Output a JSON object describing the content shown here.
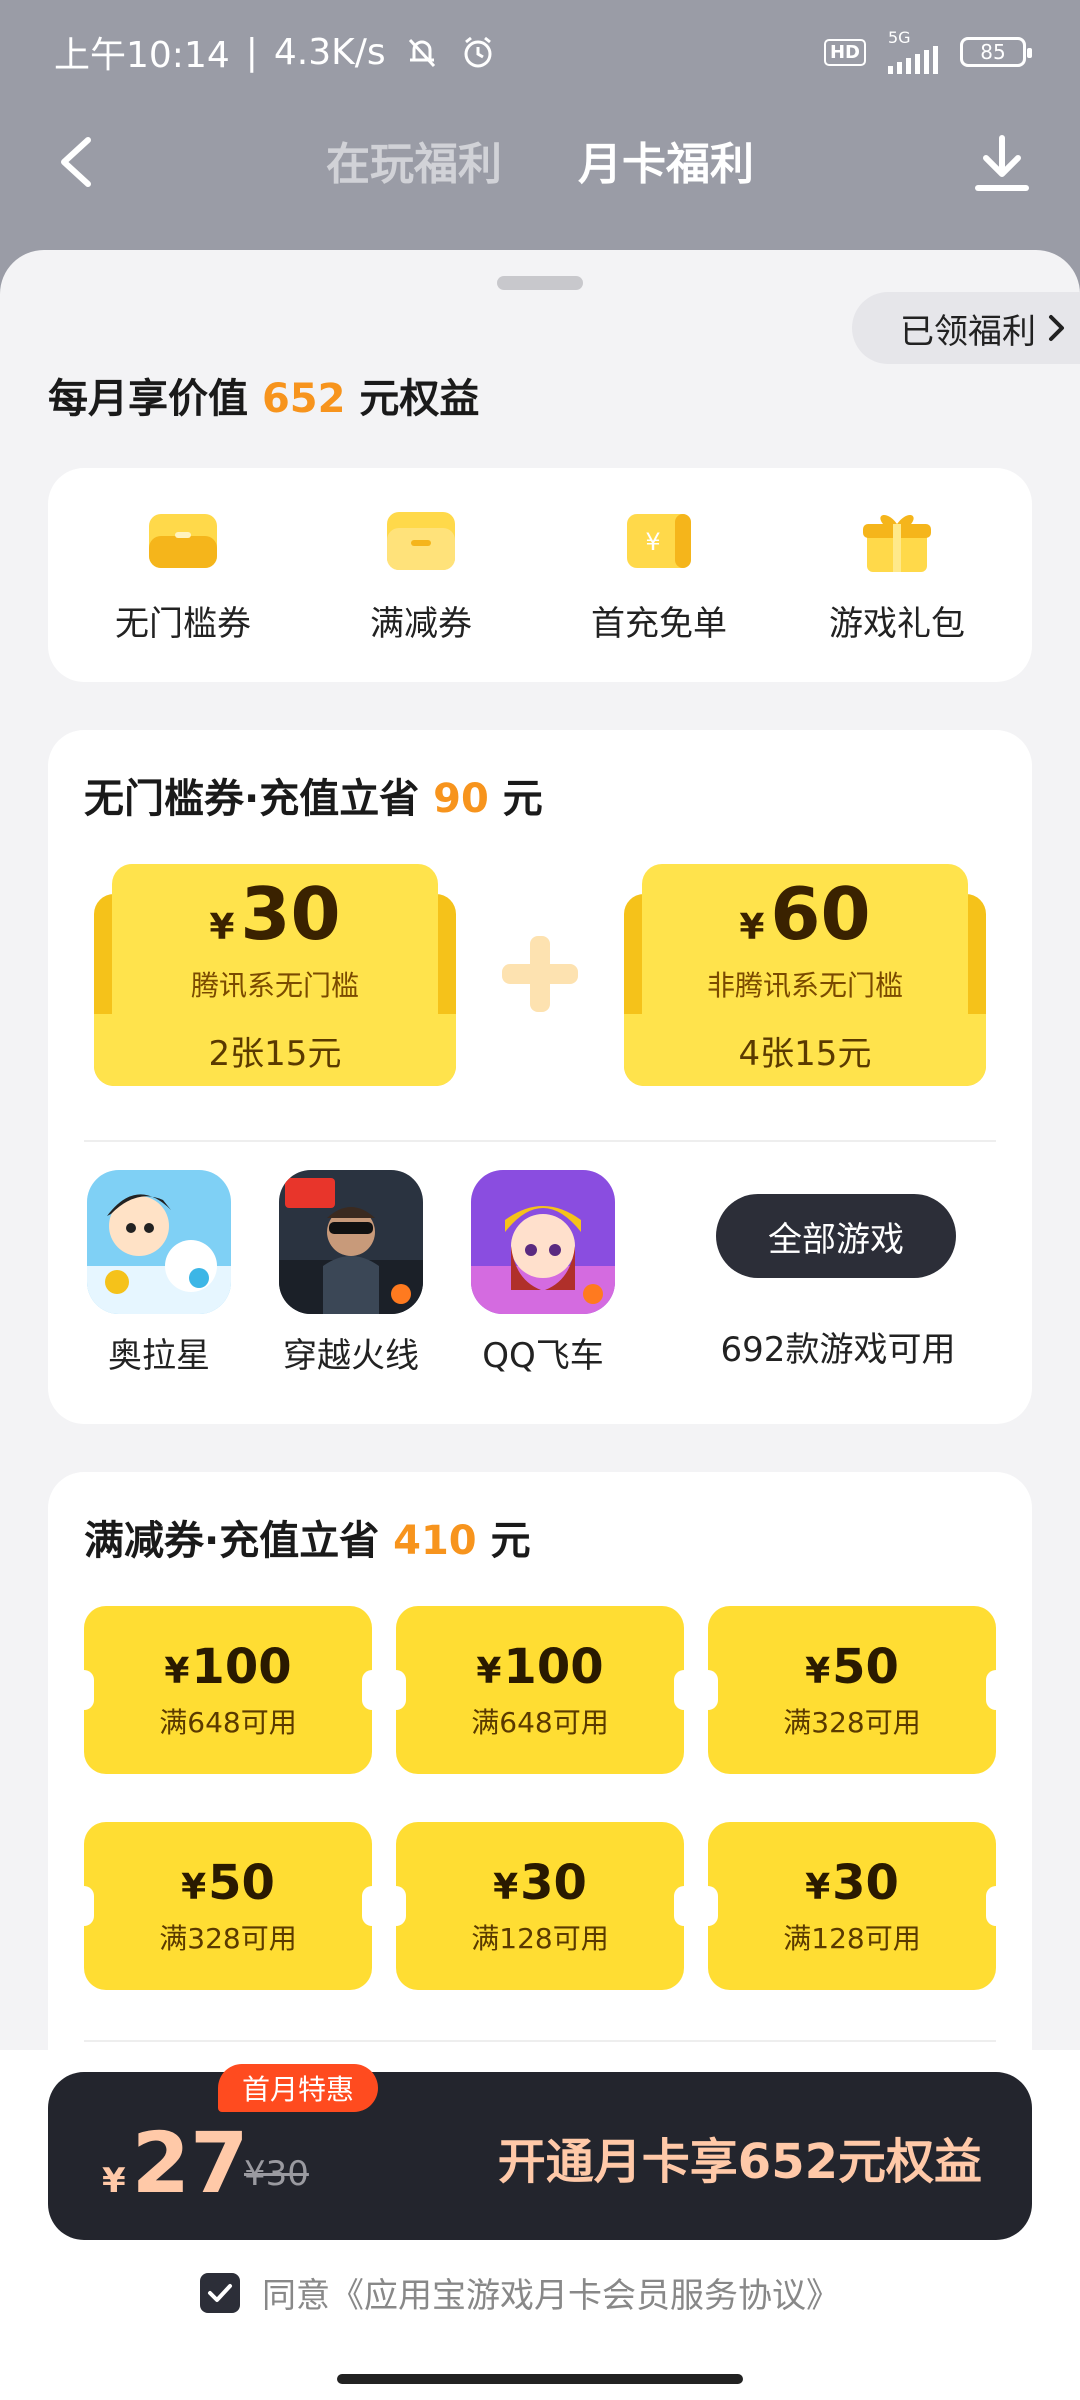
{
  "status_bar": {
    "time": "上午10:14",
    "speed": "4.3K/s",
    "hd": "HD",
    "network": "5G",
    "battery": "85"
  },
  "nav": {
    "tabs": [
      {
        "label": "在玩福利",
        "active": false
      },
      {
        "label": "月卡福利",
        "active": true
      }
    ]
  },
  "sheet": {
    "claimed_label": "已领福利",
    "headline_prefix": "每月享价值",
    "headline_value": "652",
    "headline_suffix": "元权益"
  },
  "benefits": [
    {
      "label": "无门槛券",
      "icon": "ticket-icon"
    },
    {
      "label": "满减券",
      "icon": "coupon-icon"
    },
    {
      "label": "首充免单",
      "icon": "yen-coin-icon"
    },
    {
      "label": "游戏礼包",
      "icon": "gift-icon"
    }
  ],
  "section1": {
    "title_prefix": "无门槛券·充值立省",
    "title_value": "90",
    "title_suffix": "元",
    "coupons": [
      {
        "yen": "¥",
        "amount": "30",
        "desc": "腾讯系无门槛",
        "count": "2张15元"
      },
      {
        "yen": "¥",
        "amount": "60",
        "desc": "非腾讯系无门槛",
        "count": "4张15元"
      }
    ],
    "games": [
      {
        "name": "奥拉星"
      },
      {
        "name": "穿越火线"
      },
      {
        "name": "QQ飞车"
      }
    ],
    "all_games_button": "全部游戏",
    "all_games_note": "692款游戏可用"
  },
  "section2": {
    "title_prefix": "满减券·充值立省",
    "title_value": "410",
    "title_suffix": "元",
    "coupons": [
      {
        "yen": "¥",
        "amount": "100",
        "cond": "满648可用"
      },
      {
        "yen": "¥",
        "amount": "100",
        "cond": "满648可用"
      },
      {
        "yen": "¥",
        "amount": "50",
        "cond": "满328可用"
      },
      {
        "yen": "¥",
        "amount": "50",
        "cond": "满328可用"
      },
      {
        "yen": "¥",
        "amount": "30",
        "cond": "满128可用"
      },
      {
        "yen": "¥",
        "amount": "30",
        "cond": "满128可用"
      }
    ]
  },
  "cta": {
    "promo_tag": "首月特惠",
    "yen": "¥",
    "price": "27",
    "original_price": "¥30",
    "label": "开通月卡享652元权益"
  },
  "agreement": {
    "text": "同意《应用宝游戏月卡会员服务协议》",
    "checked": true
  },
  "colors": {
    "accent_orange": "#f7941d",
    "coupon_yellow": "#ffdd33",
    "cta_dark": "#23252d",
    "promo_red": "#ff4b1f"
  }
}
